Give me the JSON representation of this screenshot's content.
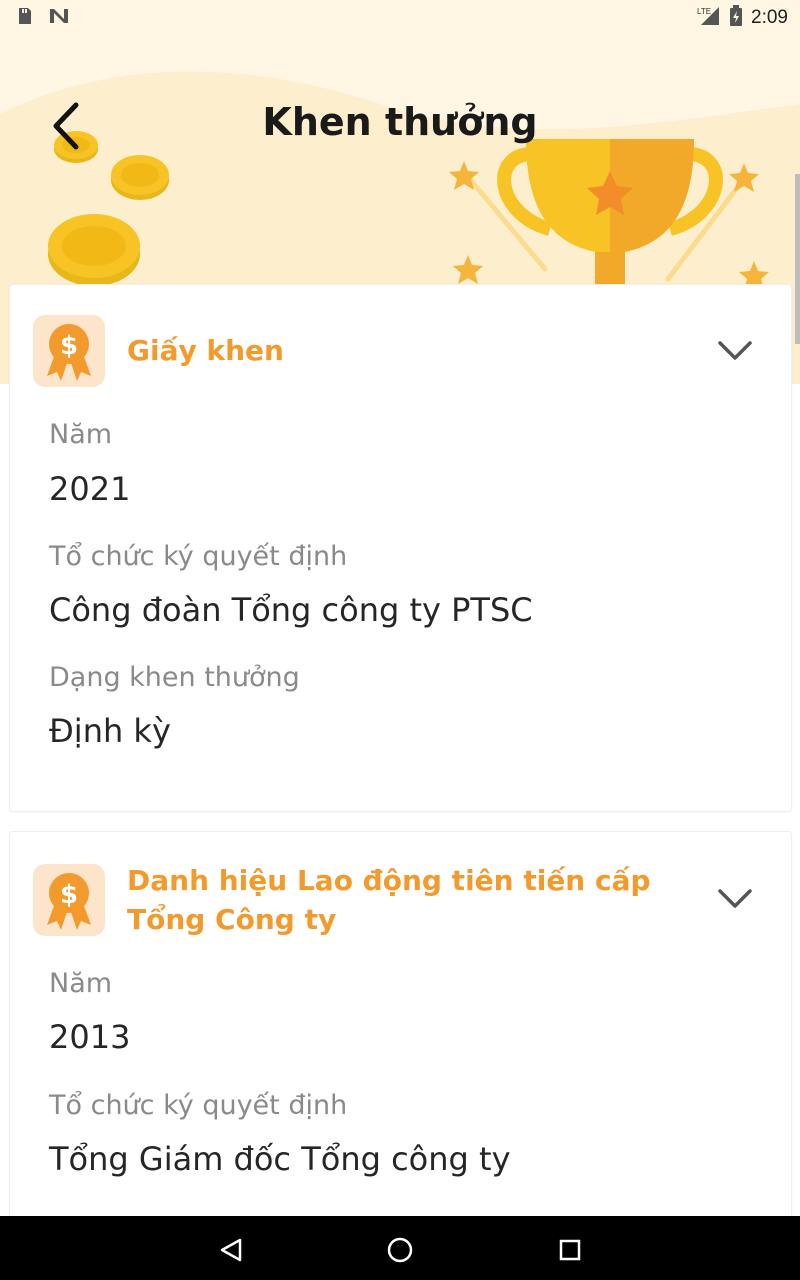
{
  "status_bar": {
    "time": "2:09",
    "network": "LTE",
    "icons": [
      "sd-card-icon",
      "n-notification-icon",
      "lte-signal-icon",
      "battery-charging-icon"
    ]
  },
  "header": {
    "title": "Khen thưởng",
    "back_icon": "chevron-left-icon"
  },
  "theme": {
    "accent": "#f39a2c",
    "hero_bg": "#fff7e3",
    "gold": "#f7c325",
    "icon_bg": "#fde5cc"
  },
  "awards": [
    {
      "title": "Giấy khen",
      "icon": "award-medal-icon",
      "fields": [
        {
          "label": "Năm",
          "value": "2021"
        },
        {
          "label": "Tổ chức ký quyết định",
          "value": "Công đoàn Tổng công ty PTSC"
        },
        {
          "label": "Dạng khen thưởng",
          "value": "Định kỳ"
        }
      ]
    },
    {
      "title_line1": "Danh hiệu Lao động tiên tiến cấp",
      "title_line2": "Tổng Công ty",
      "icon": "award-medal-icon",
      "fields": [
        {
          "label": "Năm",
          "value": "2013"
        },
        {
          "label": "Tổ chức ký quyết định",
          "value": "Tổng Giám đốc Tổng công ty"
        }
      ]
    }
  ],
  "nav_bar": {
    "buttons": [
      "back-triangle-icon",
      "home-circle-icon",
      "recents-square-icon"
    ]
  }
}
